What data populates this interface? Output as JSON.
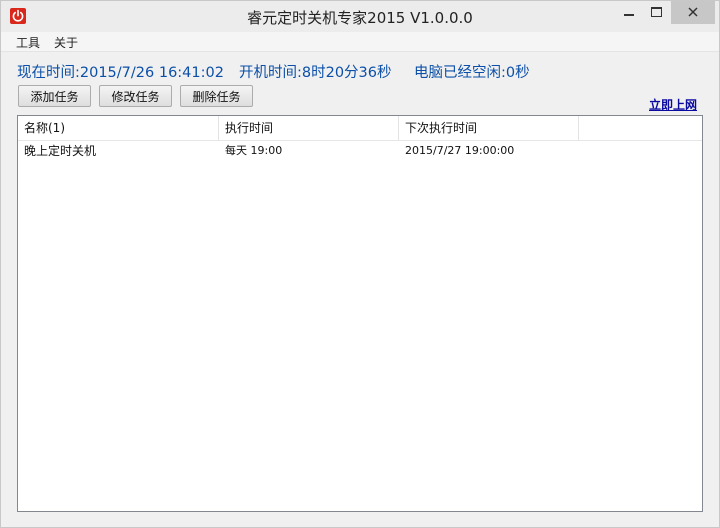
{
  "window": {
    "title": "睿元定时关机专家2015 V1.0.0.0",
    "close_color": "#c7c7c7"
  },
  "menu": {
    "items": [
      {
        "label": "工具"
      },
      {
        "label": "关于"
      }
    ]
  },
  "status": {
    "current_time": "现在时间:2015/7/26 16:41:02",
    "uptime": "开机时间:8时20分36秒",
    "idle": "电脑已经空闲:0秒"
  },
  "toolbar": {
    "add_label": "添加任务",
    "edit_label": "修改任务",
    "delete_label": "删除任务",
    "online_link": "立即上网"
  },
  "task_list": {
    "columns": [
      "名称(1)",
      "执行时间",
      "下次执行时间"
    ],
    "rows": [
      {
        "name": "晚上定时关机",
        "exec_time": "每天 19:00",
        "next_time": "2015/7/27 19:00:00"
      }
    ]
  },
  "colors": {
    "status_text": "#0c4fa8",
    "app_icon": "#d9271c",
    "link": "#0a0aa0"
  }
}
